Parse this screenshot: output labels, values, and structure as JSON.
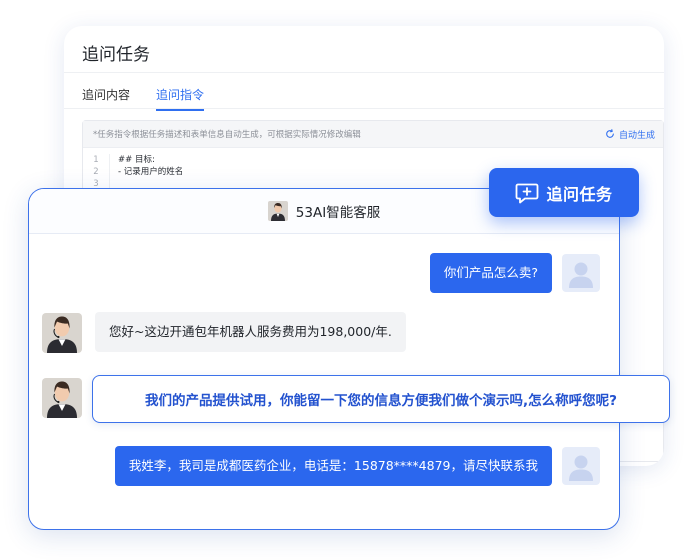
{
  "task": {
    "title": "追问任务",
    "tabs": [
      {
        "label": "追问内容",
        "active": false
      },
      {
        "label": "追问指令",
        "active": true
      }
    ],
    "editor": {
      "hint": "*任务指令根据任务描述和表单信息自动生成，可根据实际情况修改编辑",
      "auto_generate": "自动生成",
      "lines": [
        {
          "n": "1",
          "text": "## 目标:"
        },
        {
          "n": "2",
          "text": "- 记录用户的姓名"
        },
        {
          "n": "3",
          "text": ""
        }
      ]
    }
  },
  "badge": {
    "label": "追问任务",
    "icon": "chat-add-icon"
  },
  "chat": {
    "title": "53AI智能客服",
    "messages": [
      {
        "role": "user",
        "text": "你们产品怎么卖?"
      },
      {
        "role": "agent",
        "text": "您好~这边开通包年机器人服务费用为198,000/年."
      },
      {
        "role": "agent",
        "text": "我们的产品提供试用，你能留一下您的信息方便我们做个演示吗,怎么称呼您呢?",
        "highlighted": true
      },
      {
        "role": "user",
        "text": "我姓李，我司是成都医药企业，电话是：15878****4879，请尽快联系我"
      }
    ]
  },
  "colors": {
    "accent": "#2b66ee",
    "highlight_text": "#2352cf",
    "agent_bubble": "#f2f3f5",
    "user_avatar_bg": "#e6ecf9"
  }
}
